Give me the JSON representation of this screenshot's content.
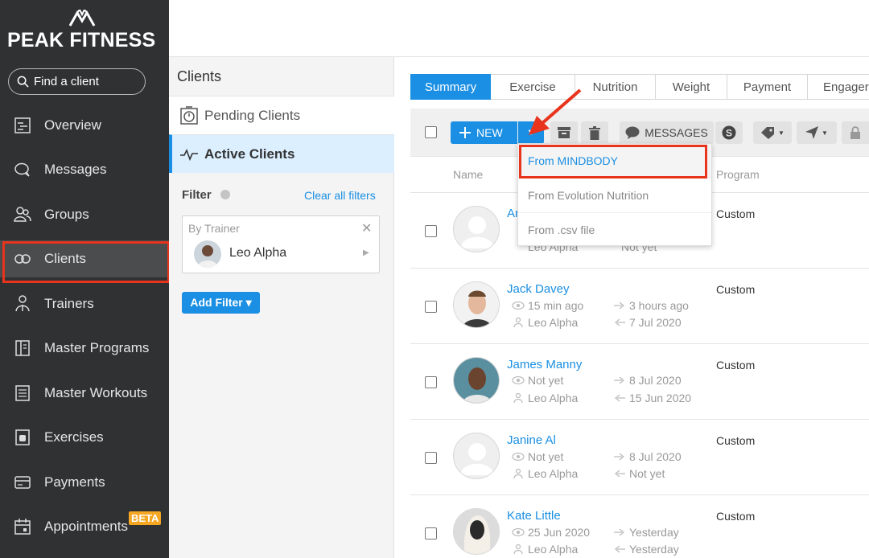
{
  "brand": {
    "name": "PEAK FITNESS"
  },
  "search": {
    "label": "Find a client"
  },
  "nav": {
    "items": [
      {
        "label": "Overview",
        "icon": "overview-icon"
      },
      {
        "label": "Messages",
        "icon": "messages-icon"
      },
      {
        "label": "Groups",
        "icon": "groups-icon"
      },
      {
        "label": "Clients",
        "icon": "clients-icon",
        "active": true
      },
      {
        "label": "Trainers",
        "icon": "trainers-icon"
      },
      {
        "label": "Master Programs",
        "icon": "master-programs-icon"
      },
      {
        "label": "Master Workouts",
        "icon": "master-workouts-icon"
      },
      {
        "label": "Exercises",
        "icon": "exercises-icon"
      },
      {
        "label": "Payments",
        "icon": "payments-icon"
      },
      {
        "label": "Appointments",
        "icon": "appointments-icon",
        "badge": "BETA"
      }
    ]
  },
  "clients_panel": {
    "title": "Clients",
    "pending": "Pending Clients",
    "active": "Active Clients",
    "filter_label": "Filter",
    "clear_filters": "Clear all filters",
    "trainer_caption": "By Trainer",
    "trainer_name": "Leo Alpha",
    "add_filter": "Add Filter ▾"
  },
  "tabs": [
    "Summary",
    "Exercise",
    "Nutrition",
    "Weight",
    "Payment",
    "Engager"
  ],
  "toolbar": {
    "new_label": "NEW",
    "messages_label": "MESSAGES"
  },
  "columns": {
    "name": "Name",
    "program": "Program"
  },
  "dropdown": {
    "items": [
      "From MINDBODY",
      "From Evolution Nutrition",
      "From .csv file"
    ]
  },
  "clients": [
    {
      "name": "An",
      "seen": "",
      "trained": "",
      "trainer": "Leo Alpha",
      "started": "Not yet",
      "program": "Custom"
    },
    {
      "name": "Jack Davey",
      "seen": "15 min ago",
      "trained": "3 hours ago",
      "trainer": "Leo Alpha",
      "started": "7 Jul 2020",
      "program": "Custom"
    },
    {
      "name": "James Manny",
      "seen": "Not yet",
      "trained": "8 Jul 2020",
      "trainer": "Leo Alpha",
      "started": "15 Jun 2020",
      "program": "Custom"
    },
    {
      "name": "Janine Al",
      "seen": "Not yet",
      "trained": "8 Jul 2020",
      "trainer": "Leo Alpha",
      "started": "Not yet",
      "program": "Custom"
    },
    {
      "name": "Kate Little",
      "seen": "25 Jun 2020",
      "trained": "Yesterday",
      "trainer": "Leo Alpha",
      "started": "Yesterday",
      "program": "Custom"
    }
  ],
  "colors": {
    "accent": "#1a8fe3",
    "nav_bg": "#2f3133",
    "highlight": "#e8341c",
    "beta": "#f5a623"
  }
}
